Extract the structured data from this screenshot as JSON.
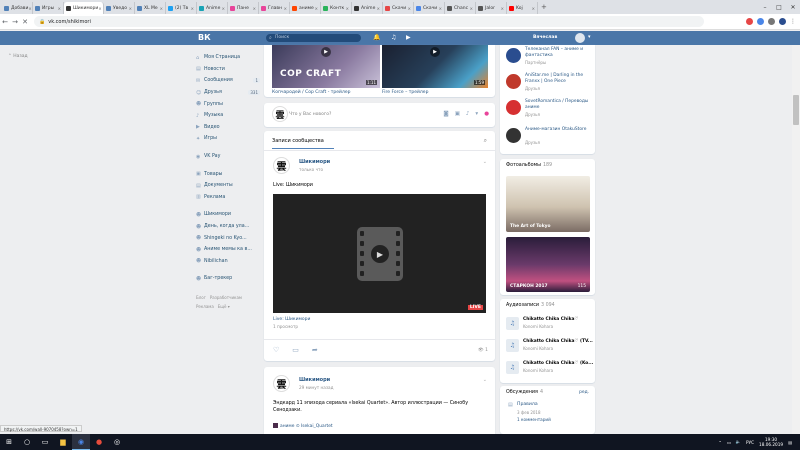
{
  "browser": {
    "tabs": [
      {
        "label": "Добави",
        "color": "#5181b8"
      },
      {
        "label": "Игры",
        "color": "#5181b8"
      },
      {
        "label": "Шикимори",
        "color": "#333333",
        "active": true
      },
      {
        "label": "Уведо",
        "color": "#5181b8"
      },
      {
        "label": "XL Ме",
        "color": "#5181b8"
      },
      {
        "label": "(2) Тв",
        "color": "#1da1f2"
      },
      {
        "label": "Anime",
        "color": "#19a3b5"
      },
      {
        "label": "Пане",
        "color": "#e8449a"
      },
      {
        "label": "Главн",
        "color": "#e8449a"
      },
      {
        "label": "аниме",
        "color": "#ff4500"
      },
      {
        "label": "Контк",
        "color": "#2ab35b"
      },
      {
        "label": "Anime",
        "color": "#333333"
      },
      {
        "label": "Скачи",
        "color": "#e64646"
      },
      {
        "label": "Скачи",
        "color": "#4a86e8"
      },
      {
        "label": "Chanc",
        "color": "#555555"
      },
      {
        "label": "Jalor",
        "color": "#555555"
      },
      {
        "label": "Koj",
        "color": "#ff0000"
      }
    ],
    "url": "vk.com/shikimori",
    "status_url": "https://vk.com/wall-9070458?own=1"
  },
  "vk": {
    "logo": "ВК",
    "search_placeholder": "Поиск",
    "user_name": "Вячеслав",
    "back_label": "Назад"
  },
  "sidebar": {
    "items": [
      {
        "icon": "home-icon",
        "glyph": "⌂",
        "label": "Моя Страница"
      },
      {
        "icon": "news-icon",
        "glyph": "▤",
        "label": "Новости"
      },
      {
        "icon": "messages-icon",
        "glyph": "✉",
        "label": "Сообщения",
        "count": "1"
      },
      {
        "icon": "friends-icon",
        "glyph": "☺",
        "label": "Друзья",
        "count": "331"
      },
      {
        "icon": "groups-icon",
        "glyph": "☻",
        "label": "Группы"
      },
      {
        "icon": "music-icon",
        "glyph": "♪",
        "label": "Музыка"
      },
      {
        "icon": "video-icon",
        "glyph": "▶",
        "label": "Видео"
      },
      {
        "icon": "games-icon",
        "glyph": "✦",
        "label": "Игры"
      }
    ],
    "items2": [
      {
        "icon": "vkpay-icon",
        "glyph": "◉",
        "label": "VK Pay"
      }
    ],
    "items3": [
      {
        "icon": "goods-icon",
        "glyph": "▣",
        "label": "Товары"
      },
      {
        "icon": "docs-icon",
        "glyph": "▤",
        "label": "Документы"
      },
      {
        "icon": "ads-icon",
        "glyph": "▥",
        "label": "Реклама"
      }
    ],
    "items4": [
      {
        "icon": "group-icon",
        "glyph": "☻",
        "label": "Шикимори"
      },
      {
        "icon": "group-icon",
        "glyph": "☻",
        "label": "День, когда ула..."
      },
      {
        "icon": "group-icon",
        "glyph": "☻",
        "label": "Shingeki no Kyo..."
      },
      {
        "icon": "group-icon",
        "glyph": "☻",
        "label": "Аниме мемы ка в..."
      },
      {
        "icon": "group-icon",
        "glyph": "☻",
        "label": "Nibilichan"
      }
    ],
    "items5": [
      {
        "icon": "bugtracker-icon",
        "glyph": "☻",
        "label": "Баг-трекер"
      }
    ],
    "footer": [
      "Блог",
      "Разработчикам",
      "Реклама",
      "Ещё ▾"
    ]
  },
  "videos": [
    {
      "caption": "COP CRAFT",
      "duration": "1:11",
      "title": "Копчародей / Cop Craft - трейлер"
    },
    {
      "caption": "",
      "duration": "1:59",
      "title": "Fire Force – трейлер"
    }
  ],
  "composer": {
    "placeholder": "Что у Вас нового?"
  },
  "feed": {
    "tab": "Записи сообщества",
    "post1": {
      "author": "Шикимори",
      "time": "только что",
      "text": "Live: Шикимори",
      "live": "LIVE",
      "video_title": "Live: Шикимори",
      "video_views": "1 просмотр",
      "views": "1"
    },
    "post2": {
      "author": "Шикимори",
      "time": "29 минут назад",
      "text": "Эндкард 11 эпизода сериала «Isekai Quartet». Автор иллюстрации — Синобу Сенодзаки.",
      "tags": "аниме  ⊙ Isekai_Quartet"
    }
  },
  "right": {
    "groups": [
      {
        "name": "Телеканал FAN – аниме и фантастика",
        "sub": "Партнёры",
        "color": "#2a4d8f"
      },
      {
        "name": "AniStar.me | Darling in the Franxx | One Piece",
        "sub": "Друзья",
        "color": "#c0392b"
      },
      {
        "name": "SovetRomantica / Переводы аниме",
        "sub": "Друзья",
        "color": "#d63031"
      },
      {
        "name": "Аниме-магазин OtakuStore",
        "sub": "Друзья",
        "color": "#333333"
      }
    ],
    "photos_label": "Фотоальбомы",
    "photos_count": "189",
    "albums": [
      {
        "title": "The Art of Tokyo",
        "count": "",
        "color": "#e7e2d6"
      },
      {
        "title": "СТАРКОН 2017",
        "count": "115",
        "color": "#4a2b4a"
      }
    ],
    "audio_label": "Аудиозаписи",
    "audio_count": "3 094",
    "tracks": [
      {
        "title": "Chikatto Chika Chika♡",
        "artist": "Konomi Kohara"
      },
      {
        "title": "Chikatto Chika Chika♡ (TV...",
        "artist": "Konomi Kohara"
      },
      {
        "title": "Chikatto Chika Chika♡ (Ko...",
        "artist": "Konomi Kohara"
      }
    ],
    "discussions_label": "Обсуждения",
    "discussions_count": "4",
    "discussions_edit": "ред.",
    "discussion": {
      "title": "Правила",
      "date": "3 фев 2018",
      "comments": "1 комментарий"
    }
  },
  "taskbar": {
    "lang": "РУС",
    "time": "19:30",
    "date": "18.06.2019"
  }
}
